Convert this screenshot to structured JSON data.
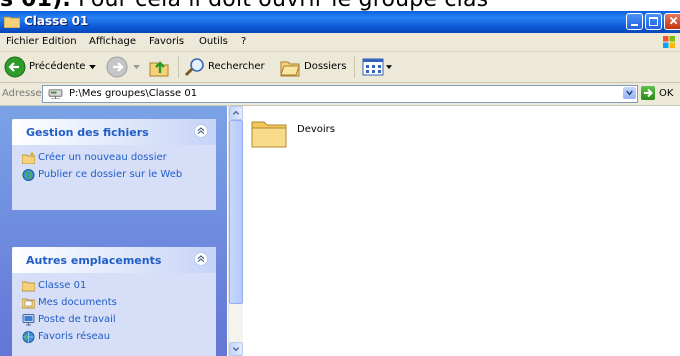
{
  "doc_line": {
    "bold": "s 01).",
    "rest": " Pour cela il doit ouvrir le groupe clas"
  },
  "window": {
    "title": "Classe 01"
  },
  "menu": [
    "Fichier",
    "Edition",
    "Affichage",
    "Favoris",
    "Outils",
    "?"
  ],
  "toolbar": {
    "back": "Précédente",
    "search": "Rechercher",
    "folders": "Dossiers"
  },
  "address": {
    "label": "Adresse",
    "value": "P:\\Mes groupes\\Classe 01",
    "go": "OK"
  },
  "tasks": {
    "file_group": {
      "title": "Gestion des fichiers",
      "items": [
        "Créer un nouveau dossier",
        "Publier ce dossier sur le Web"
      ]
    },
    "places_group": {
      "title": "Autres emplacements",
      "items": [
        "Classe 01",
        "Mes documents",
        "Poste de travail",
        "Favoris réseau"
      ]
    }
  },
  "files": [
    {
      "name": "Devoirs",
      "icon": "folder-icon"
    }
  ],
  "colors": {
    "title_bar": "#0a5fe0",
    "task_pane": "#6f8fe0",
    "link": "#215dc6"
  }
}
